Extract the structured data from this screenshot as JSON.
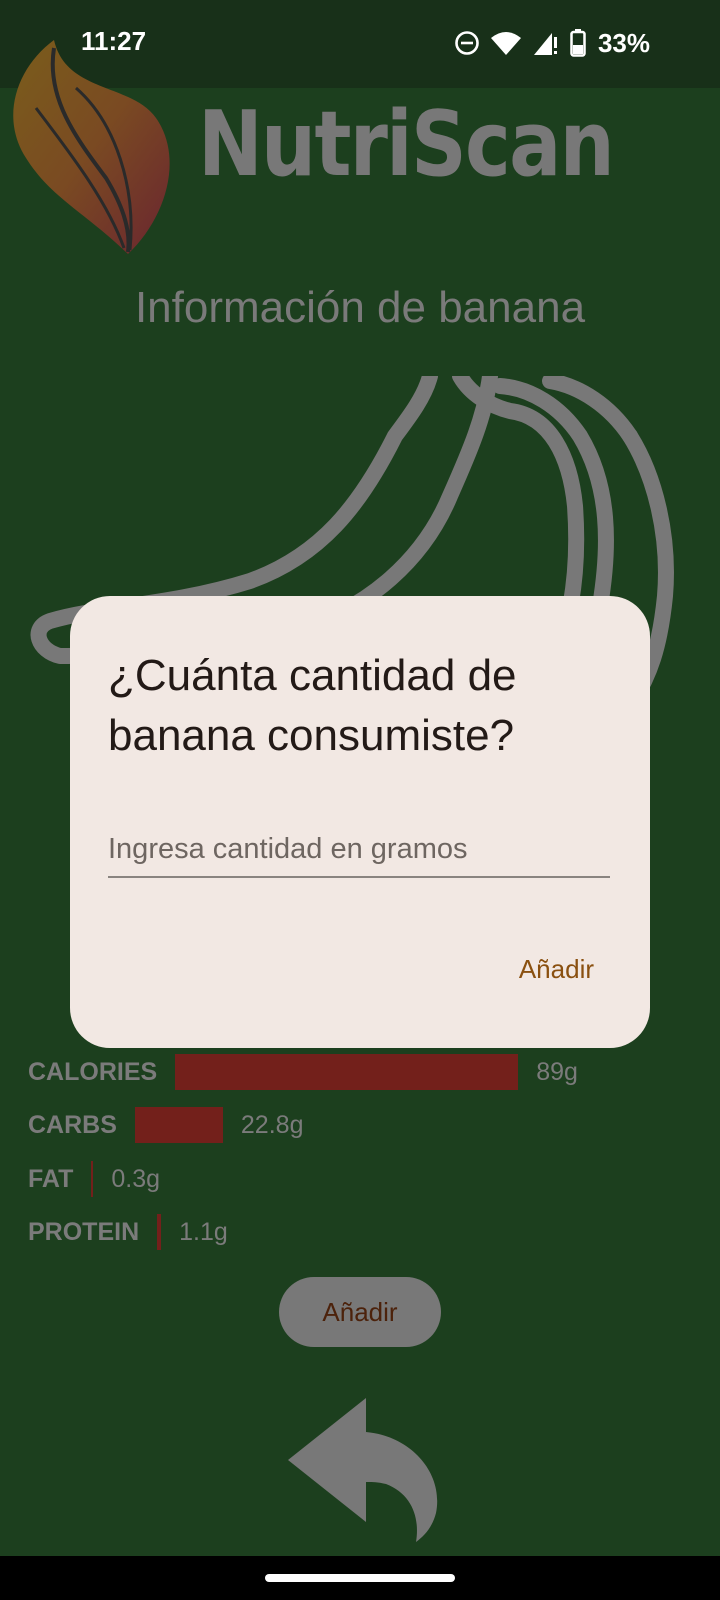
{
  "status": {
    "time": "11:27",
    "battery": "33%",
    "icons": [
      "do-not-disturb-icon",
      "wifi-icon",
      "signal-icon",
      "battery-icon"
    ]
  },
  "header": {
    "logo_text": "NutriScan",
    "title": "Información de banana"
  },
  "nutrition": [
    {
      "label": "CALORIES",
      "value": "89g"
    },
    {
      "label": "CARBS",
      "value": "22.8g"
    },
    {
      "label": "FAT",
      "value": "0.3g"
    },
    {
      "label": "PROTEIN",
      "value": "1.1g"
    }
  ],
  "actions": {
    "add_label": "Añadir"
  },
  "dialog": {
    "title": "¿Cuánta cantidad de banana  consumiste?",
    "input_placeholder": "Ingresa cantidad en gramos",
    "input_value": "",
    "confirm_label": "Añadir"
  },
  "colors": {
    "background": "#1c3f1e",
    "bar": "#73201b",
    "dialog": "#f2e8e3",
    "accent": "#8a5010"
  }
}
